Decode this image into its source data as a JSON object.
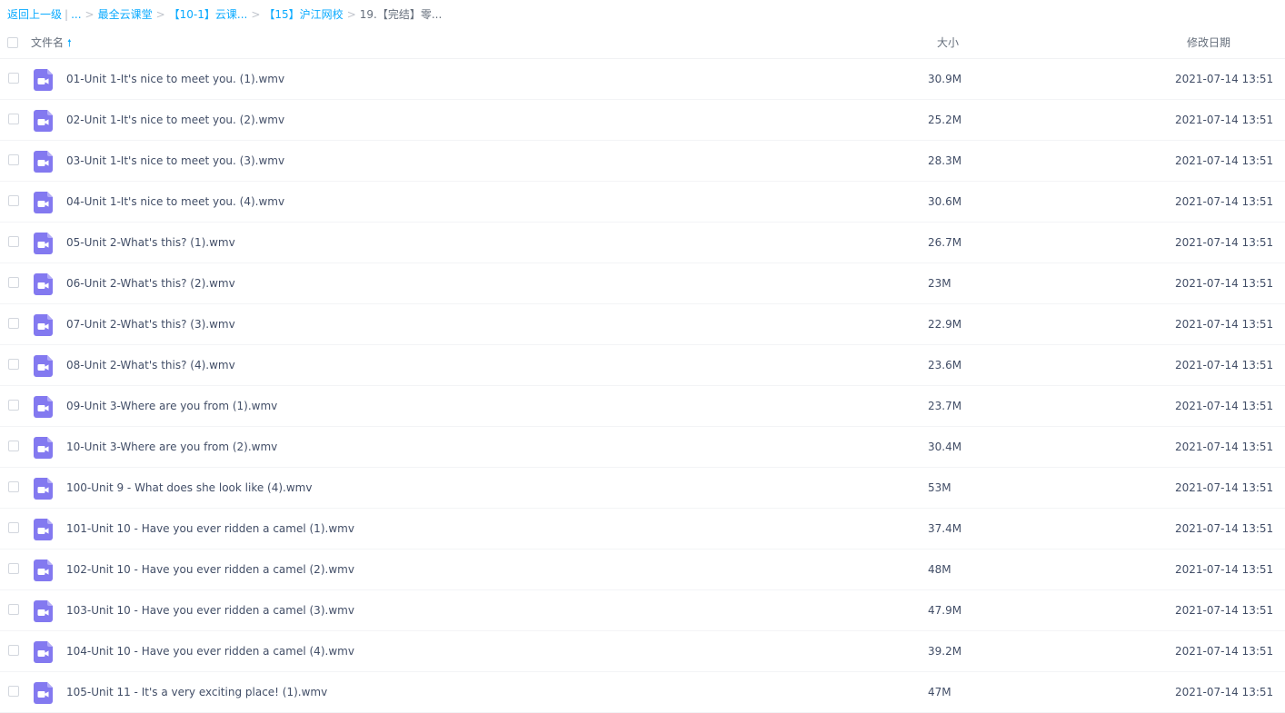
{
  "breadcrumb": {
    "back": "返回上一级",
    "pipe": "|",
    "ellipsis": "...",
    "sep": ">",
    "items": [
      "最全云课堂",
      "【10-1】云课...",
      "【15】沪江网校"
    ],
    "current": "19.【完结】零..."
  },
  "header": {
    "name": "文件名",
    "sort_icon": "arrow-up-icon",
    "size": "大小",
    "date": "修改日期"
  },
  "colors": {
    "accent": "#09aaff",
    "video_icon": "#8379f0"
  },
  "files": [
    {
      "name": "01-Unit 1-It's nice to meet you. (1).wmv",
      "size": "30.9M",
      "date": "2021-07-14 13:51"
    },
    {
      "name": "02-Unit 1-It's nice to meet you. (2).wmv",
      "size": "25.2M",
      "date": "2021-07-14 13:51"
    },
    {
      "name": "03-Unit 1-It's nice to meet you. (3).wmv",
      "size": "28.3M",
      "date": "2021-07-14 13:51"
    },
    {
      "name": "04-Unit 1-It's nice to meet you. (4).wmv",
      "size": "30.6M",
      "date": "2021-07-14 13:51"
    },
    {
      "name": "05-Unit 2-What's this? (1).wmv",
      "size": "26.7M",
      "date": "2021-07-14 13:51"
    },
    {
      "name": "06-Unit 2-What's this? (2).wmv",
      "size": "23M",
      "date": "2021-07-14 13:51"
    },
    {
      "name": "07-Unit 2-What's this? (3).wmv",
      "size": "22.9M",
      "date": "2021-07-14 13:51"
    },
    {
      "name": "08-Unit 2-What's this? (4).wmv",
      "size": "23.6M",
      "date": "2021-07-14 13:51"
    },
    {
      "name": "09-Unit 3-Where are you from (1).wmv",
      "size": "23.7M",
      "date": "2021-07-14 13:51"
    },
    {
      "name": "10-Unit 3-Where are you from (2).wmv",
      "size": "30.4M",
      "date": "2021-07-14 13:51"
    },
    {
      "name": "100-Unit 9 - What does she look like (4).wmv",
      "size": "53M",
      "date": "2021-07-14 13:51"
    },
    {
      "name": "101-Unit 10 - Have you ever ridden a camel (1).wmv",
      "size": "37.4M",
      "date": "2021-07-14 13:51"
    },
    {
      "name": "102-Unit 10 - Have you ever ridden a camel (2).wmv",
      "size": "48M",
      "date": "2021-07-14 13:51"
    },
    {
      "name": "103-Unit 10 - Have you ever ridden a camel (3).wmv",
      "size": "47.9M",
      "date": "2021-07-14 13:51"
    },
    {
      "name": "104-Unit 10 - Have you ever ridden a camel (4).wmv",
      "size": "39.2M",
      "date": "2021-07-14 13:51"
    },
    {
      "name": "105-Unit 11 - It's a very exciting place! (1).wmv",
      "size": "47M",
      "date": "2021-07-14 13:51"
    }
  ]
}
